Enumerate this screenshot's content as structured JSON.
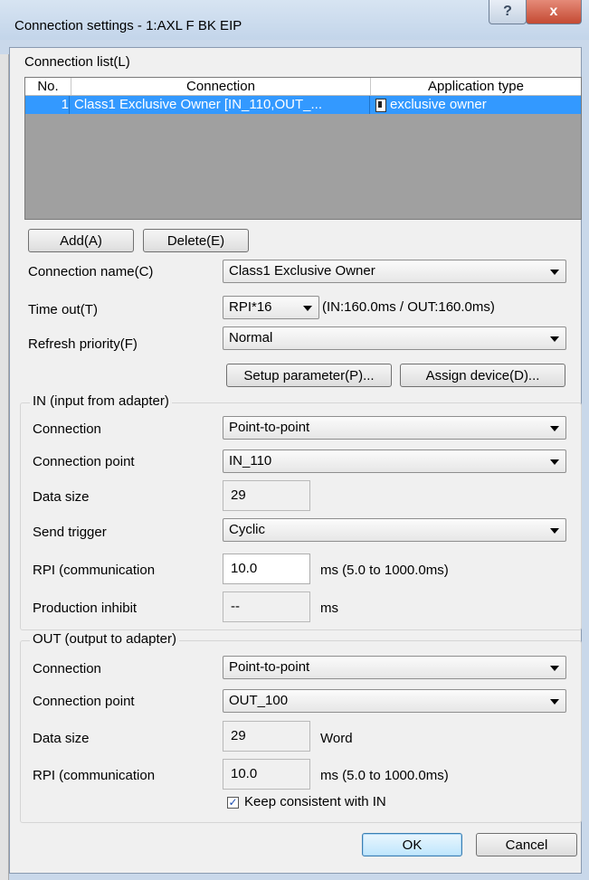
{
  "window": {
    "title": "Connection settings  - 1:AXL F BK EIP",
    "help_glyph": "?",
    "close_glyph": "x"
  },
  "connection_list": {
    "label": "Connection list(L)",
    "columns": [
      "No.",
      "Connection",
      "Application type"
    ],
    "rows": [
      {
        "no": "1",
        "connection": "Class1 Exclusive Owner [IN_110,OUT_...",
        "application_type": "exclusive owner"
      }
    ]
  },
  "list_buttons": {
    "add": "Add(A)",
    "delete": "Delete(E)"
  },
  "settings": {
    "connection_name": {
      "label": "Connection name(C)",
      "value": "Class1 Exclusive Owner"
    },
    "time_out": {
      "label": "Time out(T)",
      "value": "RPI*16",
      "info": "(IN:160.0ms / OUT:160.0ms)"
    },
    "refresh_priority": {
      "label": "Refresh priority(F)",
      "value": "Normal"
    },
    "setup_parameter_button": "Setup parameter(P)...",
    "assign_device_button": "Assign device(D)..."
  },
  "in_group": {
    "title": "IN (input from adapter)",
    "connection": {
      "label": "Connection",
      "value": "Point-to-point"
    },
    "connection_point": {
      "label": "Connection point",
      "value": "IN_110"
    },
    "data_size": {
      "label": "Data size",
      "value": "29"
    },
    "send_trigger": {
      "label": "Send trigger",
      "value": "Cyclic"
    },
    "rpi": {
      "label": "RPI (communication",
      "value": "10.0",
      "unit": "ms  (5.0 to 1000.0ms)"
    },
    "production_inhibit": {
      "label": "Production inhibit",
      "value": "--",
      "unit": "ms"
    }
  },
  "out_group": {
    "title": "OUT (output to adapter)",
    "connection": {
      "label": "Connection",
      "value": "Point-to-point"
    },
    "connection_point": {
      "label": "Connection point",
      "value": "OUT_100"
    },
    "data_size": {
      "label": "Data size",
      "value": "29",
      "unit": "Word"
    },
    "rpi": {
      "label": "RPI (communication",
      "value": "10.0",
      "unit": "ms  (5.0 to 1000.0ms)"
    },
    "keep_consistent": {
      "label": "Keep consistent with IN",
      "checked": true
    }
  },
  "footer": {
    "ok": "OK",
    "cancel": "Cancel"
  },
  "colors": {
    "selection": "#3399ff",
    "list_background": "#a0a0a0",
    "dialog_background": "#f0f0f0"
  }
}
